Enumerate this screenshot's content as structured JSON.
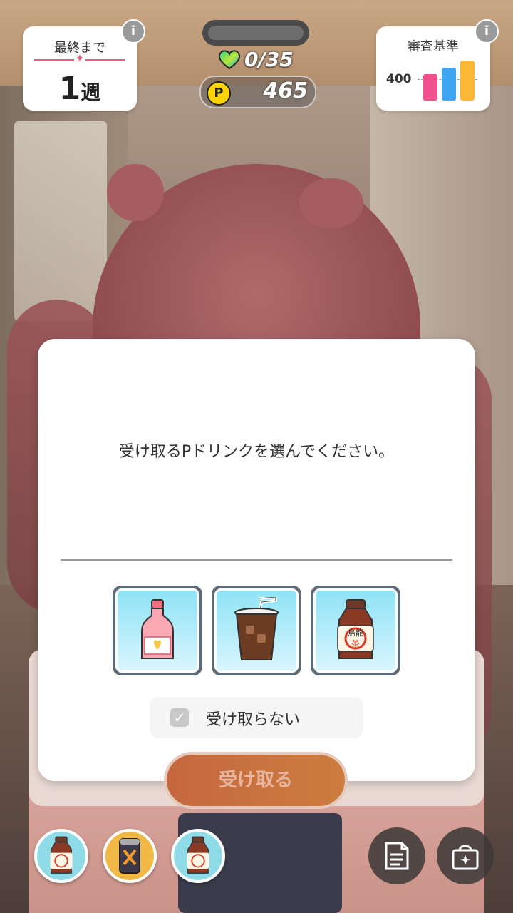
{
  "hud": {
    "week_card": {
      "title": "最終まで",
      "value": "1",
      "unit": "週"
    },
    "hearts": {
      "text": "0/35"
    },
    "points": {
      "coin_letter": "P",
      "value": "465"
    },
    "criteria": {
      "title": "審査基準",
      "label": "400",
      "bars": [
        {
          "color": "#f0508e",
          "level": 0.62
        },
        {
          "color": "#3fa4f2",
          "level": 0.76
        },
        {
          "color": "#fdb635",
          "level": 0.93
        }
      ]
    },
    "info_glyph": "i"
  },
  "dialog": {
    "message": "受け取るPドリンクを選んでください。",
    "items": [
      {
        "name": "pink-drink-bottle-icon"
      },
      {
        "name": "iced-coffee-icon"
      },
      {
        "name": "oolong-tea-bottle-icon"
      }
    ],
    "skip_label": "受け取らない",
    "receive_button": "受け取る"
  },
  "bottom_bar": {
    "drinks": [
      "oolong-tea-bottle-icon",
      "energy-can-icon",
      "oolong-tea-bottle-icon"
    ],
    "memo_icon": "memo-icon",
    "bag_icon": "bag-icon"
  },
  "colors": {
    "accent": "#f05a7e",
    "button": "#c5673f"
  }
}
